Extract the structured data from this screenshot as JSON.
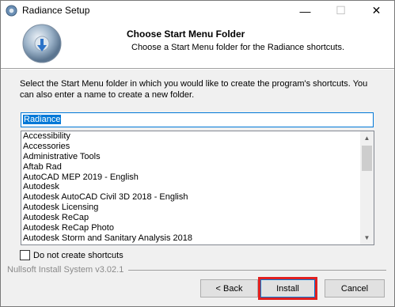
{
  "window": {
    "title": "Radiance Setup",
    "icons": {
      "app": "installer-icon",
      "minimize": "minimize-icon",
      "maximize": "maximize-icon",
      "close": "close-icon"
    }
  },
  "header": {
    "title": "Choose Start Menu Folder",
    "subtitle": "Choose a Start Menu folder for the Radiance shortcuts.",
    "logo_icon": "radiance-logo-icon"
  },
  "description": "Select the Start Menu folder in which you would like to create the program's shortcuts. You can also enter a name to create a new folder.",
  "folder_input": {
    "value": "Radiance"
  },
  "folders": [
    "Accessibility",
    "Accessories",
    "Administrative Tools",
    "Aftab Rad",
    "AutoCAD MEP 2019 - English",
    "Autodesk",
    "Autodesk AutoCAD Civil 3D 2018 - English",
    "Autodesk Licensing",
    "Autodesk ReCap",
    "Autodesk ReCap Photo",
    "Autodesk Storm and Sanitary Analysis 2018"
  ],
  "checkbox": {
    "label": "Do not create shortcuts",
    "checked": false
  },
  "footer": {
    "brand": "Nullsoft Install System v3.02.1"
  },
  "buttons": {
    "back": "< Back",
    "install": "Install",
    "cancel": "Cancel"
  },
  "colors": {
    "accent": "#0078d7",
    "highlight": "#e02020"
  }
}
